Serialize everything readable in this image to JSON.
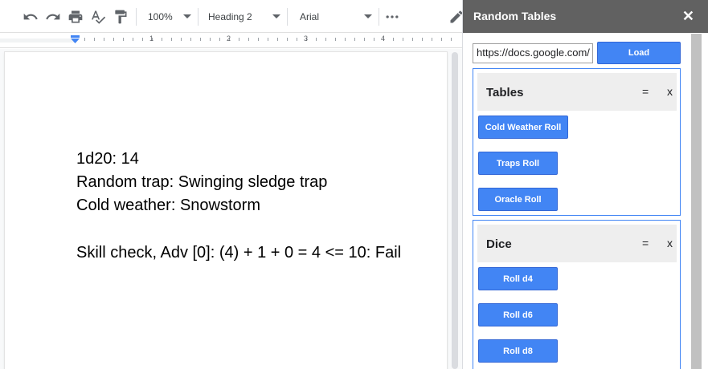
{
  "toolbar": {
    "zoom": "100%",
    "style": "Heading 2",
    "font": "Arial",
    "icons": [
      "undo-icon",
      "redo-icon",
      "print-icon",
      "spellcheck-icon",
      "paint-format-icon",
      "more-icon"
    ]
  },
  "ruler": {
    "numbers": [
      "1",
      "2",
      "3",
      "4"
    ]
  },
  "document": {
    "lines": [
      "1d20: 14",
      "Random trap: Swinging sledge trap",
      "Cold weather: Snowstorm",
      "",
      "Skill check, Adv [0]: (4) + 1 + 0 = 4 <= 10: Fail"
    ]
  },
  "sidebar": {
    "title": "Random Tables",
    "close": "✕",
    "url_value": "https://docs.google.com/",
    "load_label": "Load",
    "panels": [
      {
        "title": "Tables",
        "menu": "=",
        "close": "x",
        "buttons": [
          "Cold Weather Roll",
          "Traps Roll",
          "Oracle Roll"
        ]
      },
      {
        "title": "Dice",
        "menu": "=",
        "close": "x",
        "buttons": [
          "Roll d4",
          "Roll d6",
          "Roll d8"
        ]
      }
    ]
  },
  "colors": {
    "accent": "#4285f4",
    "sidebar_header": "#616161",
    "panel_header": "#eeeeee"
  }
}
